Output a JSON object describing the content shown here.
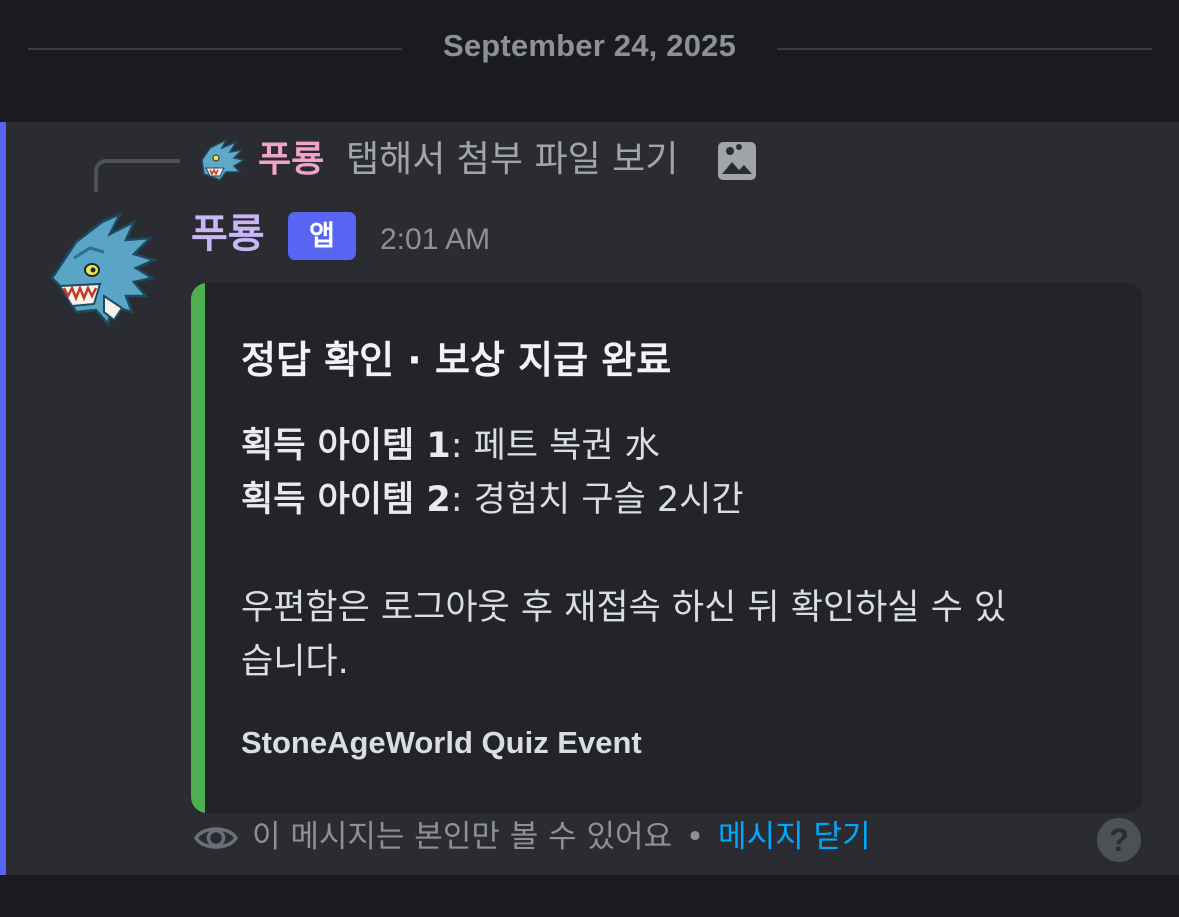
{
  "date_divider": {
    "text": "September 24, 2025"
  },
  "reply": {
    "author": "푸룡",
    "text": "탭해서 첨부 파일 보기",
    "icon": "image-icon"
  },
  "message": {
    "author": "푸룡",
    "badge": "앱",
    "timestamp": "2:01 AM",
    "avatar_icon": "dragon-avatar",
    "author_color": "#c9b6f5"
  },
  "embed": {
    "accent_color": "#4caf50",
    "title": "정답 확인 · 보상 지급 완료",
    "fields": [
      {
        "label": "획득 아이템 1",
        "value": ": 페트 복권 水"
      },
      {
        "label": "획득 아이템 2",
        "value": ": 경험치 구슬 2시간"
      }
    ],
    "description_line1": "우편함은 로그아웃 후 재접속 하신 뒤 확인하실 수 있",
    "description_line2": "습니다.",
    "footer": "StoneAgeWorld Quiz Event"
  },
  "ephemeral": {
    "icon": "eye-icon",
    "text": "이 메시지는 본인만 볼 수 있어요",
    "separator": "•",
    "dismiss_label": "메시지 닫기",
    "help_label": "?"
  },
  "colors": {
    "link": "#00a8fc",
    "highlight_bar": "#5865f2",
    "badge": "#5865f2"
  }
}
